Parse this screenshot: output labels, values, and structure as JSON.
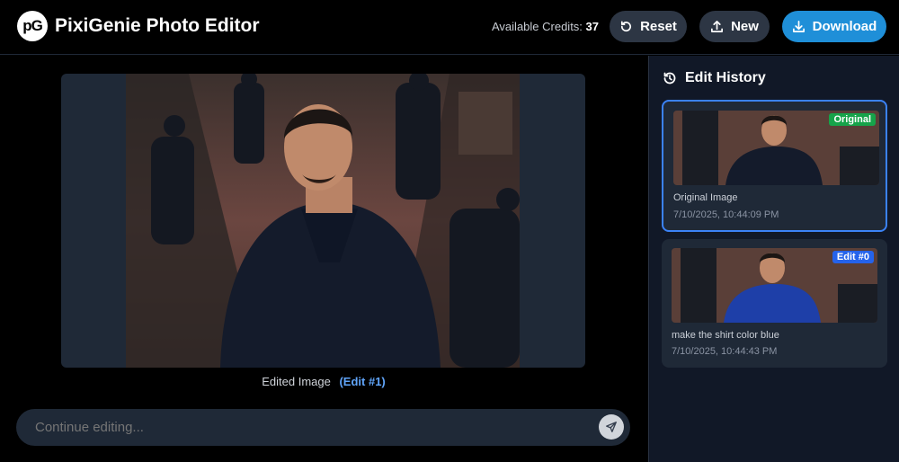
{
  "header": {
    "logo_text": "pG",
    "title": "PixiGenie Photo Editor",
    "credits_label": "Available Credits:",
    "credits_value": "37",
    "reset_label": "Reset",
    "new_label": "New",
    "download_label": "Download",
    "colors": {
      "primary_button": "#1f8fd8",
      "secondary_button": "#2d3644"
    }
  },
  "main": {
    "caption_label": "Edited Image",
    "caption_edit": "(Edit #1)",
    "chat_placeholder": "Continue editing..."
  },
  "sidebar": {
    "title": "Edit History",
    "items": [
      {
        "badge": "Original",
        "badge_color": "#16a34a",
        "description": "Original Image",
        "timestamp": "7/10/2025, 10:44:09 PM",
        "shirt_color": "#141b2b"
      },
      {
        "badge": "Edit #0",
        "badge_color": "#2563eb",
        "description": "make the shirt color blue",
        "timestamp": "7/10/2025, 10:44:43 PM",
        "shirt_color": "#1e3fa8"
      }
    ]
  }
}
